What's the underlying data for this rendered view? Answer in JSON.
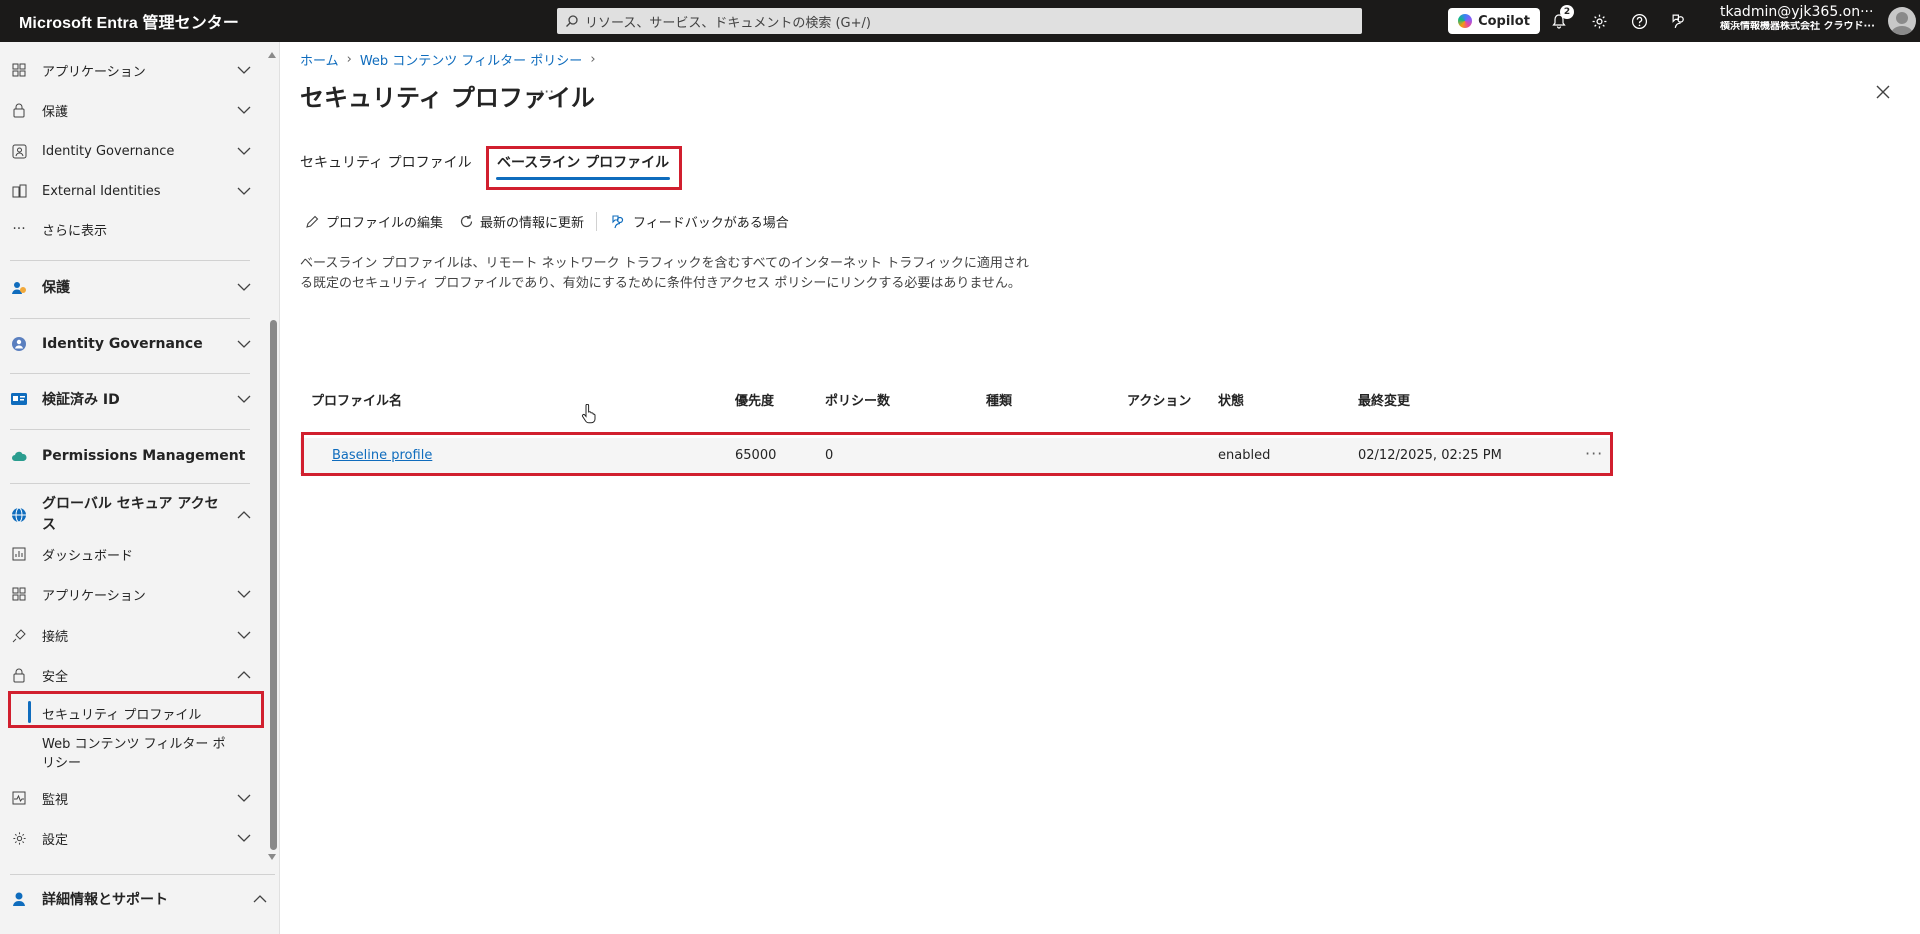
{
  "topbar": {
    "brand": "Microsoft Entra 管理センター",
    "search_placeholder": "リソース、サービス、ドキュメントの検索 (G+/)",
    "copilot_label": "Copilot",
    "notification_count": "2",
    "user_email": "tkadmin@yjk365.on···",
    "user_org": "横浜情報機器株式会社 クラウド···"
  },
  "sidebar": {
    "items": [
      {
        "label": "アプリケーション"
      },
      {
        "label": "保護"
      },
      {
        "label": "Identity Governance"
      },
      {
        "label": "External Identities"
      },
      {
        "label": "さらに表示"
      },
      {
        "label": "保護"
      },
      {
        "label": "Identity Governance"
      },
      {
        "label": "検証済み ID"
      },
      {
        "label": "Permissions Management"
      },
      {
        "label": "グローバル セキュア アクセス"
      },
      {
        "label": "ダッシュボード"
      },
      {
        "label": "アプリケーション"
      },
      {
        "label": "接続"
      },
      {
        "label": "安全"
      },
      {
        "label": "セキュリティ プロファイル"
      },
      {
        "label": "Web コンテンツ フィルター ポリシー"
      },
      {
        "label": "監視"
      },
      {
        "label": "設定"
      },
      {
        "label": "詳細情報とサポート"
      }
    ]
  },
  "main": {
    "breadcrumb": [
      "ホーム",
      "Web コンテンツ フィルター ポリシー"
    ],
    "title": "セキュリティ プロファイル",
    "tabs": [
      {
        "label": "セキュリティ プロファイル"
      },
      {
        "label": "ベースライン プロファイル"
      }
    ],
    "toolbar": {
      "edit": "プロファイルの編集",
      "refresh": "最新の情報に更新",
      "feedback": "フィードバックがある場合"
    },
    "description": "ベースライン プロファイルは、リモート ネットワーク トラフィックを含むすべてのインターネット トラフィックに適用される既定のセキュリティ プロファイルであり、有効にするために条件付きアクセス ポリシーにリンクする必要はありません。",
    "table": {
      "columns": [
        "プロファイル名",
        "優先度",
        "ポリシー数",
        "種類",
        "アクション",
        "状態",
        "最終変更"
      ],
      "rows": [
        {
          "name": "Baseline profile",
          "priority": "65000",
          "policies": "0",
          "type": "",
          "action": "",
          "state": "enabled",
          "modified": "02/12/2025, 02:25 PM"
        }
      ]
    }
  },
  "colors": {
    "accent": "#0f6cbd",
    "highlight_box": "#d11f2e",
    "topbar": "#1b1a19",
    "sidebar": "#f3f3f3"
  }
}
